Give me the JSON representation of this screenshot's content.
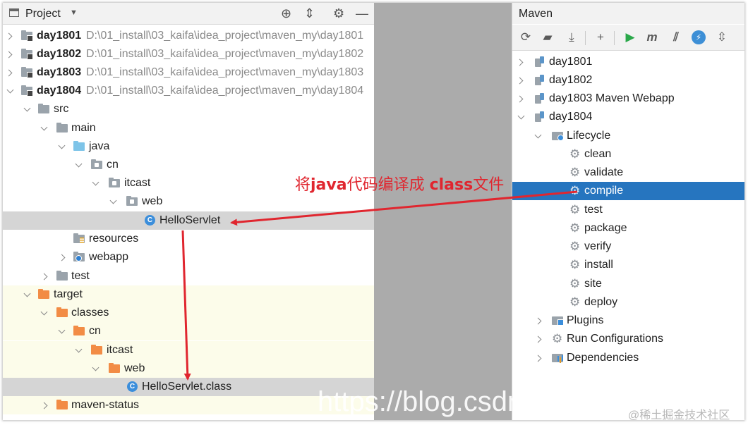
{
  "project": {
    "title": "Project",
    "tools": [
      "locate-icon",
      "collapse-icon",
      "settings-icon",
      "minimize-icon"
    ],
    "modules": [
      {
        "name": "day1801",
        "path": "D:\\01_install\\03_kaifa\\idea_project\\maven_my\\day1801"
      },
      {
        "name": "day1802",
        "path": "D:\\01_install\\03_kaifa\\idea_project\\maven_my\\day1802"
      },
      {
        "name": "day1803",
        "path": "D:\\01_install\\03_kaifa\\idea_project\\maven_my\\day1803"
      },
      {
        "name": "day1804",
        "path": "D:\\01_install\\03_kaifa\\idea_project\\maven_my\\day1804"
      }
    ],
    "tree": {
      "src": "src",
      "main": "main",
      "java": "java",
      "cn": "cn",
      "itcast": "itcast",
      "web": "web",
      "servlet": "HelloServlet",
      "resources": "resources",
      "webapp": "webapp",
      "test": "test",
      "target": "target",
      "classes": "classes",
      "t_cn": "cn",
      "t_itcast": "itcast",
      "t_web": "web",
      "class_file": "HelloServlet.class",
      "maven_status": "maven-status"
    }
  },
  "maven": {
    "title": "Maven",
    "toolbar": [
      "refresh-icon",
      "import-folder-icon",
      "download-icon",
      "add-icon",
      "run-icon",
      "maven-goal-icon",
      "toggle-offline-icon",
      "skip-tests-icon",
      "show-dependencies-icon"
    ],
    "projects": [
      "day1801",
      "day1802",
      "day1803 Maven Webapp",
      "day1804"
    ],
    "lifecycle_label": "Lifecycle",
    "phases": [
      "clean",
      "validate",
      "compile",
      "test",
      "package",
      "verify",
      "install",
      "site",
      "deploy"
    ],
    "selected_phase": "compile",
    "plugins_label": "Plugins",
    "run_configs_label": "Run Configurations",
    "dependencies_label": "Dependencies"
  },
  "annotation": {
    "part1": "将",
    "part2": "java",
    "part3": "代码编译成 ",
    "part4": "class",
    "part5": "文件"
  },
  "watermark": {
    "url": "https://blog.csdn",
    "credit": "@稀土掘金技术社区"
  },
  "colors": {
    "selection": "#2675bf",
    "annotation": "#e0262f",
    "excluded_bg": "#fcfcea"
  }
}
